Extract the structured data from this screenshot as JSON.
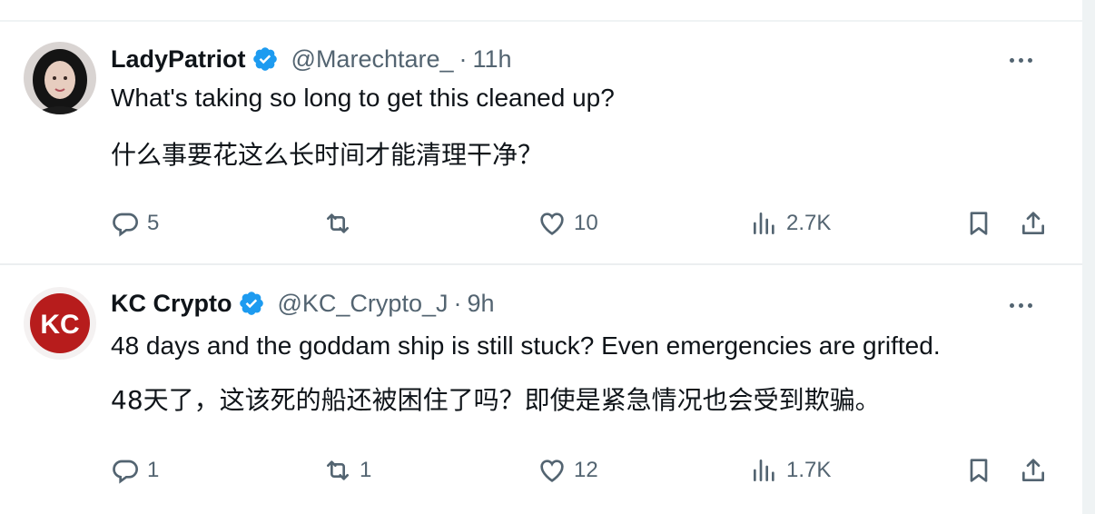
{
  "colors": {
    "verified_badge": "#1d9bf0",
    "secondary_text": "#536471",
    "primary_text": "#0f1419",
    "kc_logo_red": "#b71c1c"
  },
  "tweets": [
    {
      "avatar_icon": "profile-photo-avatar",
      "name": "LadyPatriot",
      "handle": "@Marechtare_",
      "separator": "·",
      "time": "11h",
      "text_en": "What's taking so long to get this cleaned up?",
      "text_zh": "什么事要花这么长时间才能清理干净？",
      "reply_count": "5",
      "retweet_count": "",
      "like_count": "10",
      "view_count": "2.7K"
    },
    {
      "avatar_icon": "kc-crypto-logo-avatar",
      "avatar_text": "KC",
      "name": "KC Crypto",
      "handle": "@KC_Crypto_J",
      "separator": "·",
      "time": "9h",
      "text_en": "48 days and the goddam ship is still stuck? Even emergencies are grifted.",
      "text_zh": "48天了，这该死的船还被困住了吗？即使是紧急情况也会受到欺骗。",
      "reply_count": "1",
      "retweet_count": "1",
      "like_count": "12",
      "view_count": "1.7K"
    }
  ]
}
